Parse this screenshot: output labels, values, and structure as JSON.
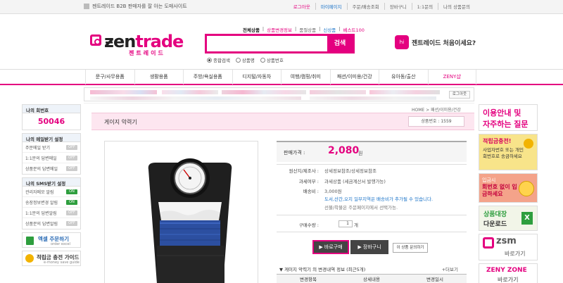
{
  "topbar": {
    "description": "젠트레이드 B2B 판매자를 잘 아는 도매사이트",
    "links": [
      "로그아웃",
      "마이페이지",
      "주문/배송조회",
      "장바구니",
      "1:1문의",
      "나의 상품문의"
    ]
  },
  "logo": {
    "text_a": "ƶen",
    "text_b": "trade",
    "sub": "젠트레이드"
  },
  "search": {
    "tabs": [
      "전체상품",
      "상품변경정보",
      "품절상품",
      "신상품",
      "베스트100"
    ],
    "placeholder": "",
    "button": "검색",
    "radios": [
      "종합검색",
      "상품명",
      "상품번호"
    ]
  },
  "welcome": {
    "icon_text": "hi",
    "text": "젠트레이드 처음이세요?"
  },
  "nav": [
    "문구/사무용품",
    "생활용품",
    "주방/욕실용품",
    "디지털/자동차",
    "여행/캠핑/취미",
    "패션/이미용/건강",
    "유아동/출산",
    "ZENY샵"
  ],
  "strip": {
    "logout": "로그아웃"
  },
  "sidebar": {
    "my_number_title": "나의 회번호",
    "my_number": "50046",
    "mail_title": "나의 메일받기 설정",
    "mail_items": [
      {
        "label": "주문메일 받기",
        "state": "OFF"
      },
      {
        "label": "1:1문의 답변메일",
        "state": "OFF"
      },
      {
        "label": "상품문의 답변메일",
        "state": "OFF"
      }
    ],
    "sms_title": "나의 SMS받기 설정",
    "sms_items": [
      {
        "label": "관리자메모 알림",
        "state": "ON"
      },
      {
        "label": "송장정보변경 알림",
        "state": "ON"
      },
      {
        "label": "1:1문의 답변알림",
        "state": "OFF"
      },
      {
        "label": "상품문의 답변알림",
        "state": "OFF"
      }
    ],
    "excel_title": "엑셀 주문하기",
    "excel_sub": "order excel",
    "guide_title": "적립금 충전 가이드",
    "guide_sub": "e-money save guide"
  },
  "breadcrumb": "HOME > 패션/이미용/건강",
  "product": {
    "title": "게이지 악력기",
    "number": "상품번호 : 1559",
    "price_label": "판매가격 :",
    "price": "2,080",
    "price_unit": "원",
    "origin_label": "원산지/제조사 :",
    "origin_value": "상세정보참조/상세정보참조",
    "tax_label": "과세여부 :",
    "tax_value": "과세상품 (세금계산서 발행가능)",
    "ship_label": "배송비 :",
    "ship_value": "3,000원",
    "ship_note1": "도서,산간,오지 일부지역은 배송비가 추가될 수 있습니다.",
    "ship_note2": "선불/착불은 주문페이지에서 선택가능.",
    "qty_label": "구매수량 :",
    "qty_value": "1",
    "qty_unit": "개",
    "buy": "바로구매",
    "cart": "장바구니",
    "ask": "이 상품 문의하기"
  },
  "changes": {
    "title": "게이지 악력기 의 변경내역 정보 (최근5개)",
    "more": "+더보기",
    "cols": [
      "변경항목",
      "상세내용",
      "변경일시"
    ]
  },
  "right_banners": [
    {
      "line1": "이용안내 및",
      "line2": "자주하는 질문"
    },
    {
      "line1": "적립금충전!",
      "line2": "사업자번호 또는 개인 회번호로 송금하세요"
    },
    {
      "line1": "입금시",
      "line2": "회번호 없이 입금하세요"
    },
    {
      "line1": "상품대장",
      "line2": "다운로드"
    },
    {
      "line1": "zsm",
      "line2": "바로가기"
    },
    {
      "line1": "ZENY ZONE",
      "line2": "바로가기"
    }
  ],
  "colors": {
    "accent": "#e4007f",
    "link": "#1a73c8",
    "toggle_on": "#2e9e3e"
  }
}
